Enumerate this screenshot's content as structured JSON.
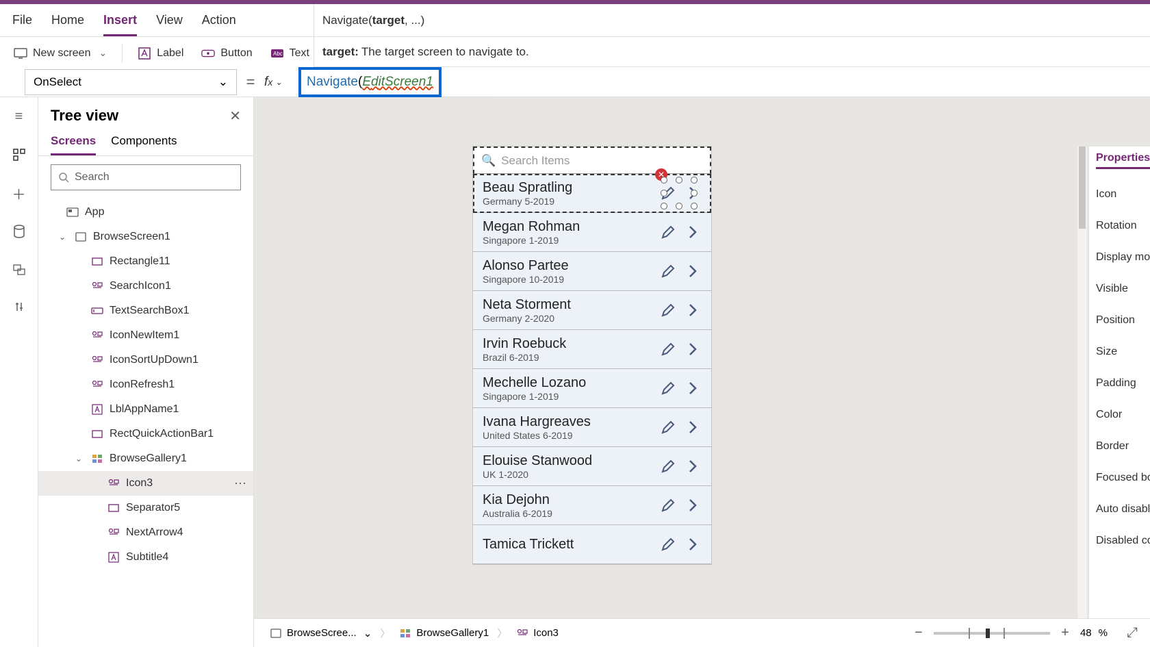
{
  "menu": {
    "file": "File",
    "home": "Home",
    "insert": "Insert",
    "view": "View",
    "action": "Action"
  },
  "toolbar": {
    "new_screen": "New screen",
    "label": "Label",
    "button": "Button",
    "text": "Text"
  },
  "signature": {
    "fn": "Navigate(",
    "bold": "target",
    "rest": ", ...)"
  },
  "hint": {
    "param": "target:",
    "desc": "The target screen to navigate to."
  },
  "prop": "OnSelect",
  "formula": {
    "fn": "Navigate",
    "open": "(",
    "arg_prefix": "E",
    "arg_cursor": "d",
    "arg_rest": "itScreen1"
  },
  "autocomplete": [
    {
      "pre": "[@",
      "bold": "EditScreen1",
      "post": "]"
    },
    {
      "pre": "",
      "bold": "EditScreen1",
      "post": ""
    }
  ],
  "tree": {
    "title": "Tree view",
    "tabs": {
      "screens": "Screens",
      "components": "Components"
    },
    "search_ph": "Search",
    "nodes": [
      {
        "label": "App",
        "indent": 0,
        "icon": "app"
      },
      {
        "label": "BrowseScreen1",
        "indent": 1,
        "icon": "screen",
        "chev": "⌄"
      },
      {
        "label": "Rectangle11",
        "indent": 2,
        "icon": "rect"
      },
      {
        "label": "SearchIcon1",
        "indent": 2,
        "icon": "ctrl"
      },
      {
        "label": "TextSearchBox1",
        "indent": 2,
        "icon": "input"
      },
      {
        "label": "IconNewItem1",
        "indent": 2,
        "icon": "ctrl"
      },
      {
        "label": "IconSortUpDown1",
        "indent": 2,
        "icon": "ctrl"
      },
      {
        "label": "IconRefresh1",
        "indent": 2,
        "icon": "ctrl"
      },
      {
        "label": "LblAppName1",
        "indent": 2,
        "icon": "label"
      },
      {
        "label": "RectQuickActionBar1",
        "indent": 2,
        "icon": "rect"
      },
      {
        "label": "BrowseGallery1",
        "indent": 2,
        "icon": "gallery",
        "chev": "⌄"
      },
      {
        "label": "Icon3",
        "indent": 3,
        "icon": "ctrl",
        "selected": true,
        "more": true
      },
      {
        "label": "Separator5",
        "indent": 3,
        "icon": "rect"
      },
      {
        "label": "NextArrow4",
        "indent": 3,
        "icon": "ctrl"
      },
      {
        "label": "Subtitle4",
        "indent": 3,
        "icon": "label"
      }
    ]
  },
  "gallery": {
    "search_ph": "Search Items",
    "rows": [
      {
        "name": "Beau Spratling",
        "sub": "Germany 5-2019",
        "sel": true
      },
      {
        "name": "Megan Rohman",
        "sub": "Singapore 1-2019"
      },
      {
        "name": "Alonso Partee",
        "sub": "Singapore 10-2019"
      },
      {
        "name": "Neta Storment",
        "sub": "Germany 2-2020"
      },
      {
        "name": "Irvin Roebuck",
        "sub": "Brazil 6-2019"
      },
      {
        "name": "Mechelle Lozano",
        "sub": "Singapore 1-2019"
      },
      {
        "name": "Ivana Hargreaves",
        "sub": "United States 6-2019"
      },
      {
        "name": "Elouise Stanwood",
        "sub": "UK 1-2020"
      },
      {
        "name": "Kia Dejohn",
        "sub": "Australia 6-2019"
      },
      {
        "name": "Tamica Trickett",
        "sub": ""
      }
    ]
  },
  "right": {
    "tab": "Properties",
    "rows": [
      "Icon",
      "Rotation",
      "Display mode",
      "Visible",
      "Position",
      "Size",
      "Padding",
      "Color",
      "Border",
      "Focused border",
      "Auto disable",
      "Disabled color"
    ]
  },
  "breadcrumbs": [
    {
      "label": "BrowseScree...",
      "icon": "screen",
      "chev": true
    },
    {
      "label": "BrowseGallery1",
      "icon": "gallery"
    },
    {
      "label": "Icon3",
      "icon": "ctrl"
    }
  ],
  "zoom": {
    "pct": "48",
    "unit": "%"
  }
}
